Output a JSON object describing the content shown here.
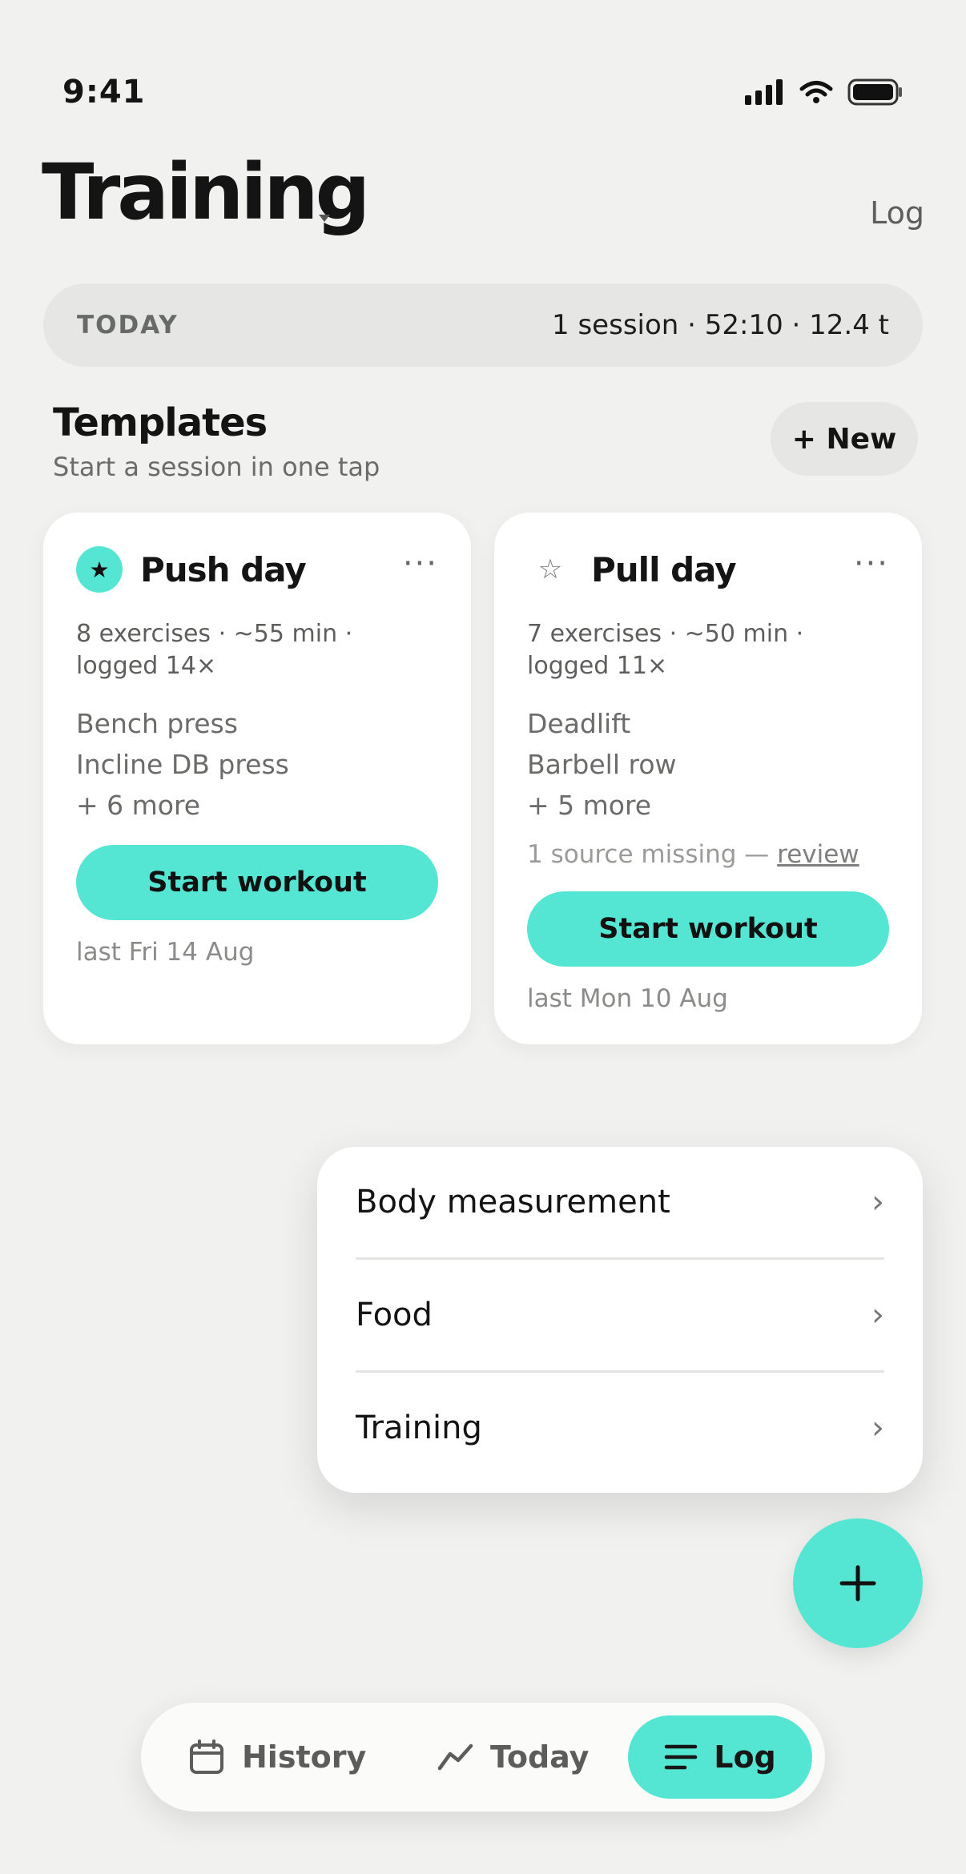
{
  "status_bar": {
    "time": "9:41",
    "icons": [
      "signal-icon",
      "wifi-icon",
      "battery-icon"
    ]
  },
  "header": {
    "title": "Training",
    "action": "Log"
  },
  "today": {
    "label": "TODAY",
    "stats": "1 session · 52:10 · 12.4 t"
  },
  "templates": {
    "title": "Templates",
    "subtitle": "Start a session in one tap",
    "new_label": "+ New",
    "cards": [
      {
        "name": "Push day",
        "starred": true,
        "meta": "8 exercises · ~55 min · logged 14×",
        "exercises": [
          "Bench press",
          "Incline DB press",
          "+ 6 more"
        ],
        "start_label": "Start workout",
        "last": "last Fri 14 Aug"
      },
      {
        "name": "Pull day",
        "starred": false,
        "meta": "7 exercises · ~50 min · logged 11×",
        "exercises": [
          "Deadlift",
          "Barbell row",
          "+ 5 more"
        ],
        "warning": "1 source missing — ",
        "warning_link": "review",
        "start_label": "Start workout",
        "last": "last Mon 10 Aug"
      }
    ]
  },
  "menu": {
    "items": [
      {
        "label": "Body measurement",
        "chevron": "›"
      },
      {
        "label": "Food",
        "chevron": "›"
      },
      {
        "label": "Training",
        "chevron": "›"
      }
    ]
  },
  "fab": {
    "icon": "plus-icon"
  },
  "bottom_nav": {
    "items": [
      {
        "label": "History",
        "icon": "calendar-icon"
      },
      {
        "label": "Today",
        "icon": "trend-icon"
      },
      {
        "label": "Log",
        "icon": "list-icon",
        "active": true
      }
    ]
  },
  "colors": {
    "accent": "#55e6d3",
    "background": "#f1f1f0",
    "card": "#ffffff",
    "pill": "#e6e7e4"
  }
}
